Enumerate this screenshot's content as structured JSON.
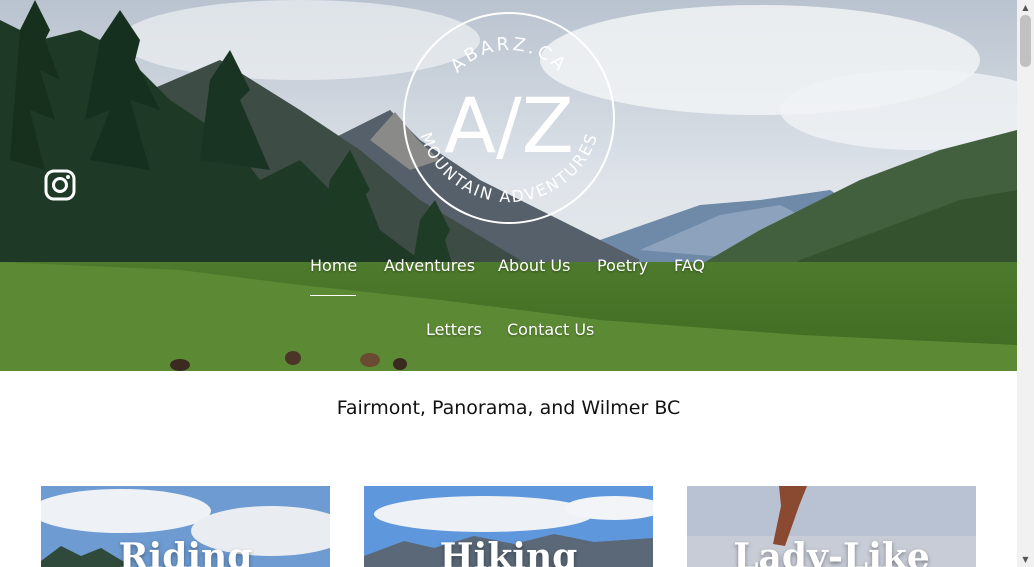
{
  "logo": {
    "ring_top": "ABARZ.CA",
    "monogram": "A/Z",
    "ring_bottom": "MOUNTAIN ADVENTURES"
  },
  "social": {
    "icon": "instagram-icon"
  },
  "nav": {
    "items": [
      "Home",
      "Adventures",
      "About Us",
      "Poetry",
      "FAQ",
      "Letters",
      "Contact Us"
    ],
    "active": "Home"
  },
  "subtitle": "Fairmont, Panorama, and Wilmer BC",
  "cards": [
    {
      "title": "Riding"
    },
    {
      "title": "Hiking"
    },
    {
      "title": "Lady-Like"
    }
  ],
  "colors": {
    "nav_text": "#ffffff",
    "page_bg": "#ffffff"
  }
}
